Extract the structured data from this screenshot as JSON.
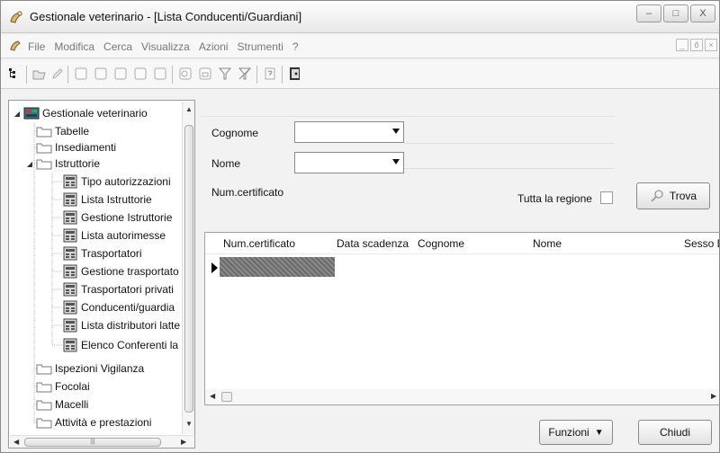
{
  "window": {
    "title": "Gestionale veterinario - [Lista Conducenti/Guardiani]",
    "controls": {
      "minimize": "–",
      "maximize": "□",
      "close": "X"
    }
  },
  "menubar": {
    "items": [
      "File",
      "Modifica",
      "Cerca",
      "Visualizza",
      "Azioni",
      "Strumenti",
      "?"
    ],
    "mdi": {
      "minimize": "_",
      "restore": "ő",
      "close": "×"
    }
  },
  "tree": {
    "root": "Gestionale veterinario",
    "items": [
      {
        "label": "Tabelle",
        "type": "folder",
        "level": 1
      },
      {
        "label": "Insediamenti",
        "type": "folder",
        "level": 1
      },
      {
        "label": "Istruttorie",
        "type": "folder",
        "level": 1,
        "expanded": true
      },
      {
        "label": "Tipo autorizzazioni",
        "type": "doc",
        "level": 2
      },
      {
        "label": "Lista Istruttorie",
        "type": "doc",
        "level": 2
      },
      {
        "label": "Gestione Istruttorie",
        "type": "doc",
        "level": 2
      },
      {
        "label": "Lista autorimesse",
        "type": "doc",
        "level": 2
      },
      {
        "label": "Trasportatori",
        "type": "doc",
        "level": 2
      },
      {
        "label": "Gestione trasportato",
        "type": "doc",
        "level": 2
      },
      {
        "label": "Trasportatori privati",
        "type": "doc",
        "level": 2
      },
      {
        "label": "Conducenti/guardia",
        "type": "doc",
        "level": 2
      },
      {
        "label": "Lista distributori latte",
        "type": "doc",
        "level": 2
      },
      {
        "label": "Elenco Conferenti la",
        "type": "doc",
        "level": 2
      },
      {
        "label": "Ispezioni Vigilanza",
        "type": "folder",
        "level": 1
      },
      {
        "label": "Focolai",
        "type": "folder",
        "level": 1
      },
      {
        "label": "Macelli",
        "type": "folder",
        "level": 1
      },
      {
        "label": "Attività e prestazioni",
        "type": "folder",
        "level": 1
      }
    ],
    "hscroll_thumb": "|||"
  },
  "form": {
    "cognome_label": "Cognome",
    "cognome_value": "",
    "nome_label": "Nome",
    "nome_value": "",
    "num_certificato_label": "Num.certificato",
    "tutta_regione_label": "Tutta la regione",
    "tutta_regione_checked": false,
    "trova_button": "Trova"
  },
  "grid": {
    "columns": [
      "Num.certificato",
      "Data scadenza",
      "Cognome",
      "Nome",
      "Sesso D"
    ],
    "rows": []
  },
  "footer": {
    "funzioni_button": "Funzioni",
    "chiudi_button": "Chiudi"
  }
}
